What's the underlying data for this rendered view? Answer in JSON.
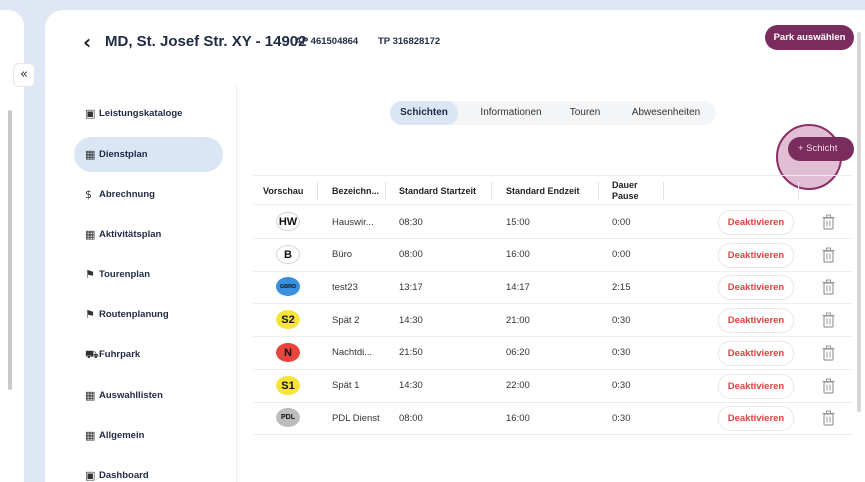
{
  "header": {
    "back_icon": "chevron-left-icon",
    "title": "MD, St. Josef Str. XY - 14902",
    "ap": "AP 461504864",
    "tp": "TP 316828172",
    "park_button": "Park auswählen"
  },
  "collapse_glyph": "«",
  "sidebar": {
    "items": [
      {
        "label": "Leistungskataloge",
        "icon": "catalog-icon",
        "glyph": "▣"
      },
      {
        "label": "Dienstplan",
        "icon": "calendar-icon",
        "glyph": "▦"
      },
      {
        "label": "Abrechnung",
        "icon": "dollar-icon",
        "glyph": "$"
      },
      {
        "label": "Aktivitätsplan",
        "icon": "calendar-icon",
        "glyph": "▦"
      },
      {
        "label": "Tourenplan",
        "icon": "flag-icon",
        "glyph": "⚑"
      },
      {
        "label": "Routenplanung",
        "icon": "flag-icon",
        "glyph": "⚑"
      },
      {
        "label": "Fuhrpark",
        "icon": "car-icon",
        "glyph": "⛟"
      },
      {
        "label": "Auswahllisten",
        "icon": "calendar-icon",
        "glyph": "▦"
      },
      {
        "label": "Allgemein",
        "icon": "calendar-icon",
        "glyph": "▦"
      },
      {
        "label": "Dashboard",
        "icon": "dashboard-icon",
        "glyph": "▣"
      }
    ],
    "active_index": 1
  },
  "tabs": [
    {
      "label": "Schichten",
      "active": true
    },
    {
      "label": "Informationen",
      "active": false
    },
    {
      "label": "Touren",
      "active": false
    },
    {
      "label": "Abwesenheiten",
      "active": false
    }
  ],
  "add_button": {
    "icon": "plus-icon",
    "label": "+ Schicht"
  },
  "table": {
    "headers": [
      "Vorschau",
      "Bezeichn...",
      "Standard Startzeit",
      "Standard Endzeit",
      "Dauer Pause",
      "",
      ""
    ],
    "rows": [
      {
        "badge": "HW",
        "badge_color": "#ffffff",
        "name": "Hauswir...",
        "start": "08:30",
        "end": "15:00",
        "pause": "0:00",
        "action": "Deaktivieren"
      },
      {
        "badge": "B",
        "badge_color": "#ffffff",
        "name": "Büro",
        "start": "08:00",
        "end": "16:00",
        "pause": "0:00",
        "action": "Deaktivieren"
      },
      {
        "badge": "GBRD",
        "badge_color": "#3b8fe0",
        "name": "test23",
        "start": "13:17",
        "end": "14:17",
        "pause": "2:15",
        "action": "Deaktivieren"
      },
      {
        "badge": "S2",
        "badge_color": "#f6e43a",
        "name": "Spät 2",
        "start": "14:30",
        "end": "21:00",
        "pause": "0:30",
        "action": "Deaktivieren"
      },
      {
        "badge": "N",
        "badge_color": "#e8453c",
        "name": "Nachtdi...",
        "start": "21:50",
        "end": "06:20",
        "pause": "0:30",
        "action": "Deaktivieren"
      },
      {
        "badge": "S1",
        "badge_color": "#f6e43a",
        "name": "Spät 1",
        "start": "14:30",
        "end": "22:00",
        "pause": "0:30",
        "action": "Deaktivieren"
      },
      {
        "badge": "PDL",
        "badge_color": "#bdbdbd",
        "name": "PDL Dienst",
        "start": "08:00",
        "end": "16:00",
        "pause": "0:30",
        "action": "Deaktivieren"
      }
    ]
  },
  "colors": {
    "accent": "#7a2c5f",
    "active_bg": "#dbe6f5",
    "danger": "#d9443f"
  }
}
